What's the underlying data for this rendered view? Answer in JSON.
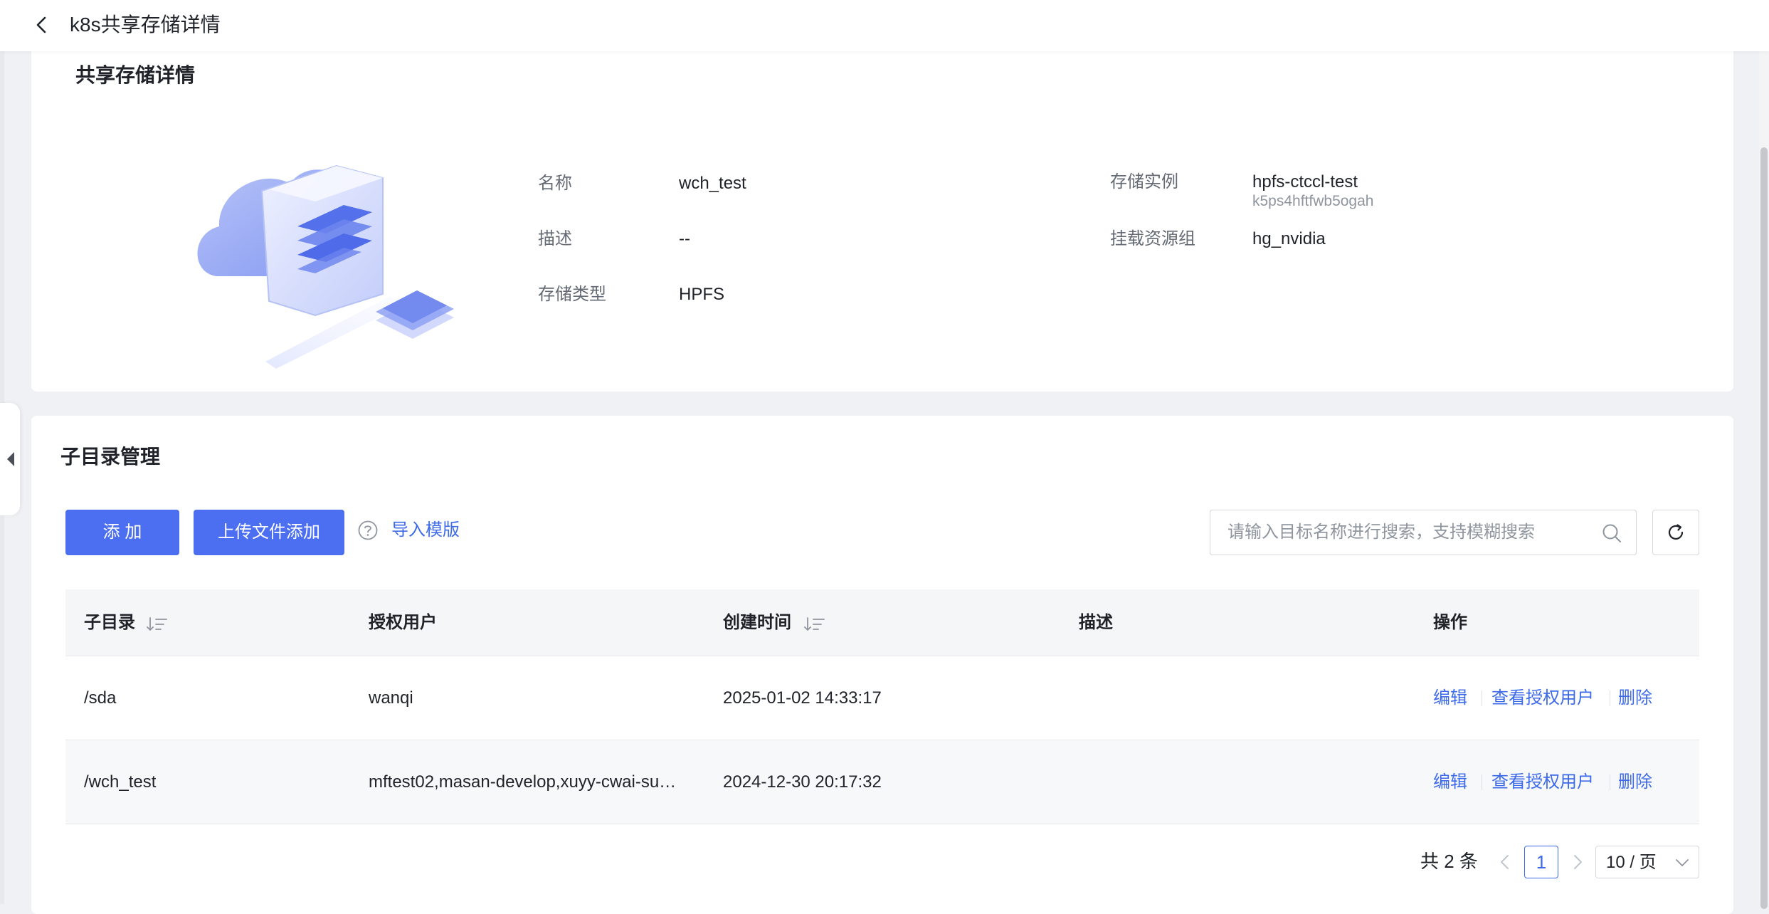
{
  "header": {
    "title": "k8s共享存储详情"
  },
  "detail": {
    "title": "共享存储详情",
    "fields": {
      "name_label": "名称",
      "name_value": "wch_test",
      "desc_label": "描述",
      "desc_value": "--",
      "type_label": "存储类型",
      "type_value": "HPFS",
      "instance_label": "存储实例",
      "instance_value": "hpfs-ctccl-test",
      "instance_id": "k5ps4hftfwb5ogah",
      "group_label": "挂载资源组",
      "group_value": "hg_nvidia"
    }
  },
  "subdir": {
    "title": "子目录管理",
    "add_button": "添 加",
    "upload_button": "上传文件添加",
    "template_link": "导入模版",
    "search": {
      "placeholder": "请输入目标名称进行搜索，支持模糊搜索",
      "value": ""
    },
    "columns": {
      "dir": "子目录",
      "users": "授权用户",
      "created": "创建时间",
      "desc": "描述",
      "ops": "操作"
    },
    "rows": [
      {
        "dir": "/sda",
        "users": "wanqi",
        "created": "2025-01-02 14:33:17",
        "desc": ""
      },
      {
        "dir": "/wch_test",
        "users": "mftest02,masan-develop,xuyy-cwai-su…",
        "created": "2024-12-30 20:17:32",
        "desc": ""
      }
    ],
    "ops": {
      "edit": "编辑",
      "view_users": "查看授权用户",
      "delete": "删除"
    },
    "pagination": {
      "total": "共 2 条",
      "current": "1",
      "page_size": "10 / 页"
    }
  },
  "colors": {
    "primary": "#4c6ef0",
    "link": "#3d6ae8",
    "background": "#f0f1f4"
  }
}
